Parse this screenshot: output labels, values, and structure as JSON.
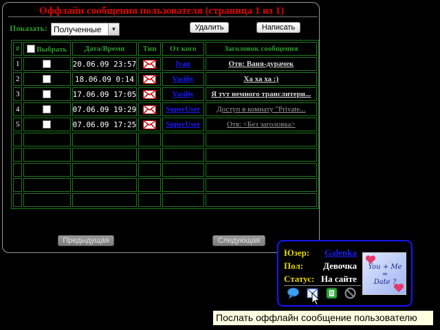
{
  "page": {
    "title": "Оффлайн сообщения пользователя (страница 1 из 1)"
  },
  "toolbar": {
    "show_label": "Показать:",
    "filter_value": "Полученные",
    "delete_label": "Удалить",
    "write_label": "Написать"
  },
  "table": {
    "headers": [
      "#",
      "Выбрать",
      "Дата/Время",
      "Тип",
      "От кого",
      "Заголовок сообщения"
    ],
    "rows": [
      {
        "num": "1",
        "date": "20.06.09 23:57",
        "from": "Ivan",
        "subject": "Отв: Ваня-дурачек",
        "read": false
      },
      {
        "num": "2",
        "date": "18.06.09 0:14",
        "from": "Vasiliy",
        "subject": "Ха ха ха :)",
        "read": false
      },
      {
        "num": "3",
        "date": "17.06.09 17:05",
        "from": "Vasiliy",
        "subject": "Я тут немного транслитери...",
        "read": false
      },
      {
        "num": "4",
        "date": "07.06.09 19:29",
        "from": "SuperUser",
        "subject": "Доступ в комнату \"Private...",
        "read": true
      },
      {
        "num": "5",
        "date": "07.06.09 17:25",
        "from": "SuperUser",
        "subject": "Отв: <Без заголовка>",
        "read": true
      }
    ],
    "empty_rows": 5
  },
  "pagination": {
    "prev_label": "Предыдущая",
    "next_label": "Следующая"
  },
  "user_card": {
    "user_label": "Юзер:",
    "user_value": "Galenka",
    "gender_label": "Пол:",
    "gender_value": "Девочка",
    "status_label": "Статус:",
    "status_value": "На сайте",
    "avatar_text_line1": "You + Me",
    "avatar_text_line2": "=",
    "avatar_text_line3": "Date ?",
    "icons": [
      "chat-bubble-icon",
      "envelope-icon",
      "add-contact-icon",
      "block-icon"
    ]
  },
  "tooltip": {
    "text": "Послать оффлайн сообщение пользователю"
  },
  "colors": {
    "title": "#e60000",
    "table_border": "#1f7a1f",
    "header_text": "#2d9b2d",
    "link": "#1a1aff",
    "card_border": "#1515ff",
    "card_label": "#e8d800"
  }
}
